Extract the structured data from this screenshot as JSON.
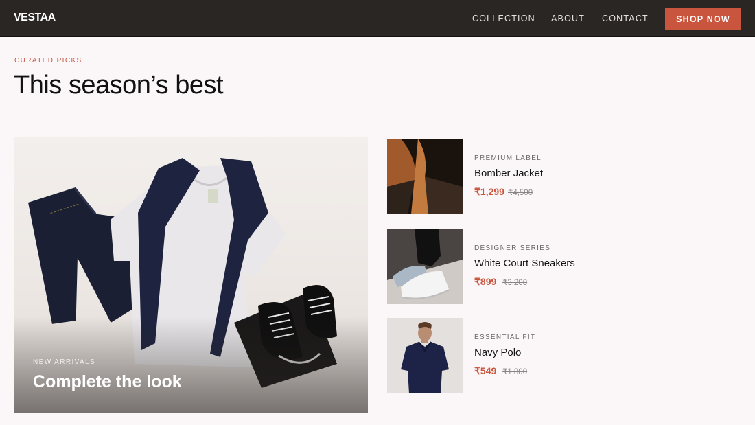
{
  "brand": {
    "logo": "VESTAA"
  },
  "nav": {
    "links": [
      "COLLECTION",
      "ABOUT",
      "CONTACT"
    ],
    "cta": "SHOP NOW"
  },
  "section": {
    "eyebrow": "CURATED PICKS",
    "title": "This season’s best"
  },
  "hero": {
    "eyebrow": "NEW ARRIVALS",
    "title": "Complete the look"
  },
  "products": [
    {
      "label": "PREMIUM LABEL",
      "name": "Bomber Jacket",
      "price": "₹1,299",
      "old_price": "₹4,500"
    },
    {
      "label": "DESIGNER SERIES",
      "name": "White Court Sneakers",
      "price": "₹899",
      "old_price": "₹3,200"
    },
    {
      "label": "ESSENTIAL FIT",
      "name": "Navy Polo",
      "price": "₹549",
      "old_price": "₹1,800"
    }
  ],
  "colors": {
    "accent": "#c9553e",
    "header": "#2a2624",
    "background": "#fbf7f8"
  }
}
